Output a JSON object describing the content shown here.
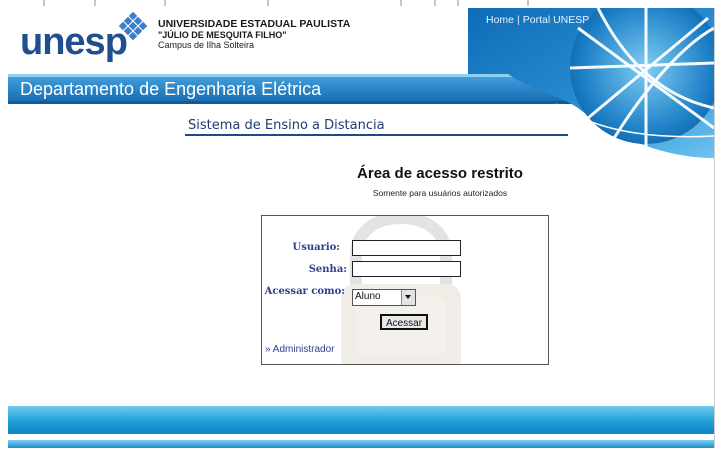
{
  "header": {
    "logo_text": "unesp",
    "university_name": "UNIVERSIDADE ESTADUAL PAULISTA",
    "university_sub": "\"JÚLIO DE MESQUITA FILHO\"",
    "campus": "Campus de Ilha Solteira",
    "links": [
      "Home",
      "Portal UNESP"
    ],
    "link_separator": "|"
  },
  "department": {
    "title": "Departamento de Engenharia Elétrica"
  },
  "system": {
    "title": "Sistema de Ensino a Distancia"
  },
  "access": {
    "title": "Área de acesso restrito",
    "subtitle": "Somente para usuários autorizados"
  },
  "login_form": {
    "user_label": "Usuario:",
    "user_value": "",
    "password_label": "Senha:",
    "password_value": "",
    "role_label": "Acessar como:",
    "role_selected": "Aluno",
    "submit_label": "Acessar",
    "admin_link": "» Administrador"
  },
  "colors": {
    "brand_blue": "#1f4f8f",
    "dept_bar": "#2b84c8",
    "footer": "#21a0d8",
    "label_blue": "#2e3f8f"
  }
}
